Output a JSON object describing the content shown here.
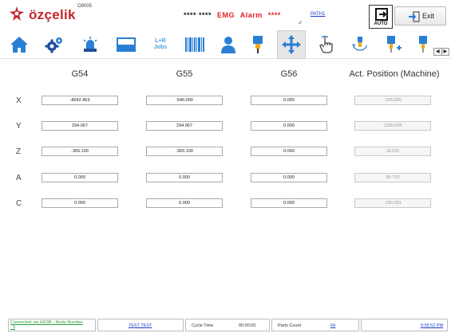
{
  "header": {
    "logo_text": "özçelik",
    "program_number": "O9005",
    "status": {
      "stars_left": "**** ****",
      "emg": "EMG",
      "alarm": "Alarm",
      "stars_right": "****"
    },
    "path_link": "PATH1",
    "mode_label": "AUTO",
    "exit_label": "Exit"
  },
  "toolbar": {
    "tools": [
      {
        "icon": "home-icon"
      },
      {
        "icon": "settings-gears-icon"
      },
      {
        "icon": "alarm-beacon-icon"
      },
      {
        "icon": "window-screen-icon"
      },
      {
        "icon": "jobs-icon",
        "label_top": "L+R",
        "label_bottom": "Jobs"
      },
      {
        "icon": "barcode-icon"
      },
      {
        "icon": "user-icon"
      },
      {
        "icon": "spindle-tool-icon"
      },
      {
        "icon": "move-axes-icon"
      },
      {
        "icon": "hand-jog-icon"
      },
      {
        "icon": "axis-rotate-icon"
      },
      {
        "icon": "tool-add-icon"
      },
      {
        "icon": "tool-edit-icon"
      }
    ],
    "active_tool_index": 8
  },
  "grid": {
    "columns": [
      "G54",
      "G55",
      "G56",
      "Act. Position (Machine)"
    ],
    "rows": [
      {
        "axis": "X",
        "values": [
          "-8642.453",
          "-546.000",
          "0.000",
          "-205.820"
        ]
      },
      {
        "axis": "Y",
        "values": [
          "294.067",
          "294.067",
          "0.000",
          "1330.005"
        ]
      },
      {
        "axis": "Z",
        "values": [
          "-365.100",
          "-365.100",
          "0.000",
          "18.532"
        ]
      },
      {
        "axis": "A",
        "values": [
          "0.000",
          "0.000",
          "0.000",
          "89.733"
        ]
      },
      {
        "axis": "C",
        "values": [
          "0.000",
          "0.000",
          "0.000",
          "-180.001"
        ]
      }
    ]
  },
  "statusbar": {
    "connection_line1": "Connected via HSSB - Node Number",
    "connection_line2": ": 9",
    "test_link": "TEST TEST",
    "cycle_time_label": "Cycle Time",
    "cycle_time_value": "00:00:00",
    "parts_count_label": "Parts Count",
    "parts_count_value": "64",
    "clock": "9:55:52 PM"
  },
  "colors": {
    "brand_red": "#c4242b",
    "alarm_red": "#e31f26",
    "link_blue": "#1a3acb",
    "icon_blue": "#2a7fd4",
    "connection_green": "#2f9c3c"
  }
}
